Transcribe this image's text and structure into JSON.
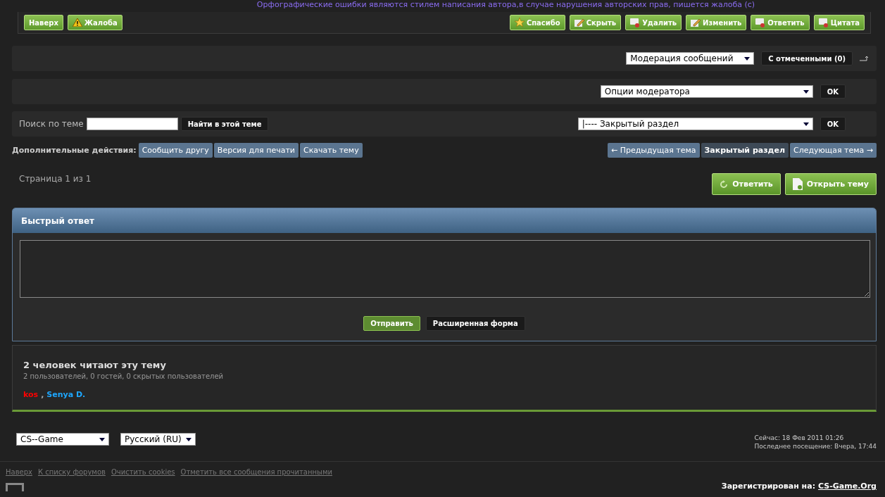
{
  "signature": "Орфографические ошибки являются стилем написания автора,в случае нарушения авторских прав, пишется жалоба (с)",
  "post_bar": {
    "left": [
      {
        "label": "Наверх"
      },
      {
        "label": "Жалоба"
      }
    ],
    "right": [
      {
        "label": "Спасибо"
      },
      {
        "label": "Скрыть"
      },
      {
        "label": "Удалить"
      },
      {
        "label": "Изменить"
      },
      {
        "label": "Ответить"
      },
      {
        "label": "Цитата"
      }
    ]
  },
  "moderation": {
    "select": "Модерация сообщений",
    "button": "С отмеченными (0)"
  },
  "moderator_options": {
    "select": "Опции модератора",
    "button": "OK"
  },
  "search": {
    "label": "Поиск по теме",
    "button": "Найти в этой теме",
    "jump_select": "|---- Закрытый раздел",
    "jump_button": "OK"
  },
  "extra_actions": {
    "label": "Дополнительные действия:",
    "left": [
      {
        "label": "Сообщить другу",
        "selected": false
      },
      {
        "label": "Версия для печати",
        "selected": false
      },
      {
        "label": "Скачать тему",
        "selected": false
      }
    ],
    "right": [
      {
        "label": "← Предыдущая тема",
        "selected": false
      },
      {
        "label": "Закрытый раздел",
        "selected": true
      },
      {
        "label": "Следующая тема →",
        "selected": false
      }
    ]
  },
  "pagination": "Страница 1 из 1",
  "topic_buttons": [
    {
      "label": "Ответить"
    },
    {
      "label": "Открыть тему"
    }
  ],
  "quick_reply": {
    "title": "Быстрый ответ",
    "buttons": [
      {
        "label": "Отправить",
        "primary": true
      },
      {
        "label": "Расширенная форма",
        "primary": false
      }
    ]
  },
  "readers": {
    "title": "2 человек читают эту тему",
    "summary": "2 пользователей, 0 гостей, 0 скрытых пользователей",
    "separator": ",",
    "users": [
      {
        "name": "kos",
        "color": "#ff0000"
      },
      {
        "name": "Senya D.",
        "color": "#1ea7ff"
      }
    ]
  },
  "footer": {
    "skin": "CS--Game",
    "language": "Русский (RU)",
    "now": "Сейчас: 18 Фев 2011 01:26",
    "last_visit": "Последнее посещение: Вчера, 17:44",
    "links": [
      "Наверх",
      "К списку форумов",
      "Очистить cookies",
      "Отметить все сообщения прочитанными"
    ],
    "registered_label": "Зарегистрирован на:",
    "registered_link": "CS-Game.Org"
  }
}
